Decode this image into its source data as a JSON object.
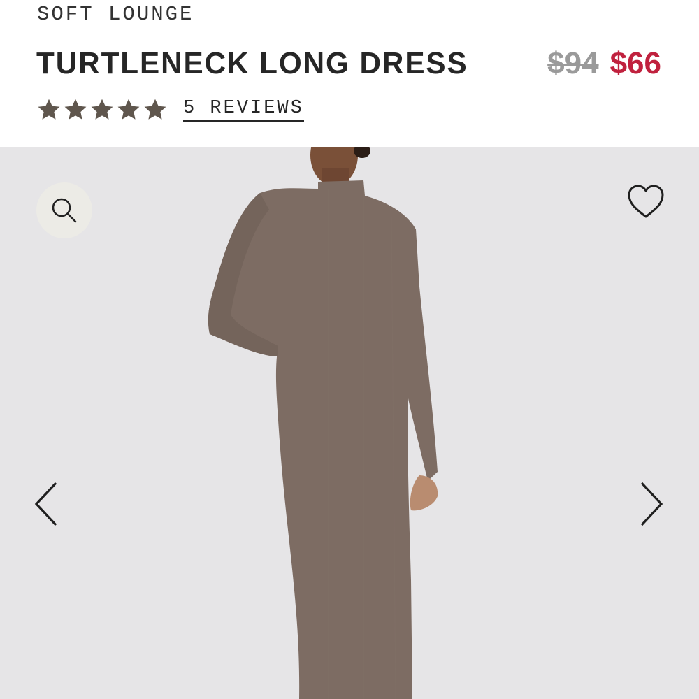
{
  "product": {
    "collection": "SOFT LOUNGE",
    "name": "TURTLENECK LONG DRESS",
    "price_original": "$94",
    "price_sale": "$66",
    "rating": 5,
    "rating_max": 5,
    "reviews_label": "5 REVIEWS"
  },
  "colors": {
    "sale_price": "#c0213e",
    "strike_price": "#9a9a9a",
    "star": "#5f564d",
    "gallery_bg": "#e6e5e7",
    "dress": "#7d6c63"
  },
  "gallery": {
    "zoom_icon": "search-icon",
    "favorite_icon": "heart-outline-icon",
    "prev_icon": "chevron-left-icon",
    "next_icon": "chevron-right-icon"
  }
}
